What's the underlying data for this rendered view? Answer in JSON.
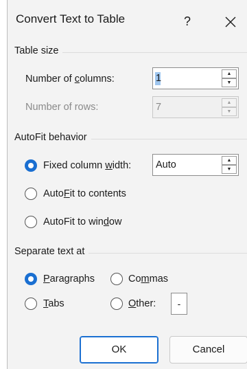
{
  "title": "Convert Text to Table",
  "titlebar": {
    "help": "?",
    "close": "X"
  },
  "table_size": {
    "group_title": "Table size",
    "columns": {
      "label_pre": "Number of ",
      "label_ul": "c",
      "label_post": "olumns:",
      "value": "1"
    },
    "rows": {
      "label": "Number of rows:",
      "value": "7",
      "disabled": true
    }
  },
  "autofit": {
    "group_title": "AutoFit behavior",
    "fixed": {
      "label_pre": "Fixed column ",
      "label_ul": "w",
      "label_post": "idth:",
      "value": "Auto",
      "checked": true
    },
    "contents": {
      "label_pre": "Auto",
      "label_ul": "F",
      "label_post": "it to contents",
      "checked": false
    },
    "window": {
      "label_pre": "AutoFit to win",
      "label_ul": "d",
      "label_post": "ow",
      "checked": false
    }
  },
  "separate": {
    "group_title": "Separate text at",
    "paragraphs": {
      "label_ul": "P",
      "label_post": "aragraphs",
      "checked": true
    },
    "commas": {
      "label_pre": "Co",
      "label_ul": "m",
      "label_post": "mas",
      "checked": false
    },
    "tabs": {
      "label_ul": "T",
      "label_post": "abs",
      "checked": false
    },
    "other": {
      "label_ul": "O",
      "label_post": "ther:",
      "value": "-",
      "checked": false
    }
  },
  "buttons": {
    "ok": "OK",
    "cancel": "Cancel"
  },
  "colors": {
    "accent": "#1a6fd1",
    "dialog_bg": "#f3f3f3",
    "selection": "#9fc6ef"
  }
}
